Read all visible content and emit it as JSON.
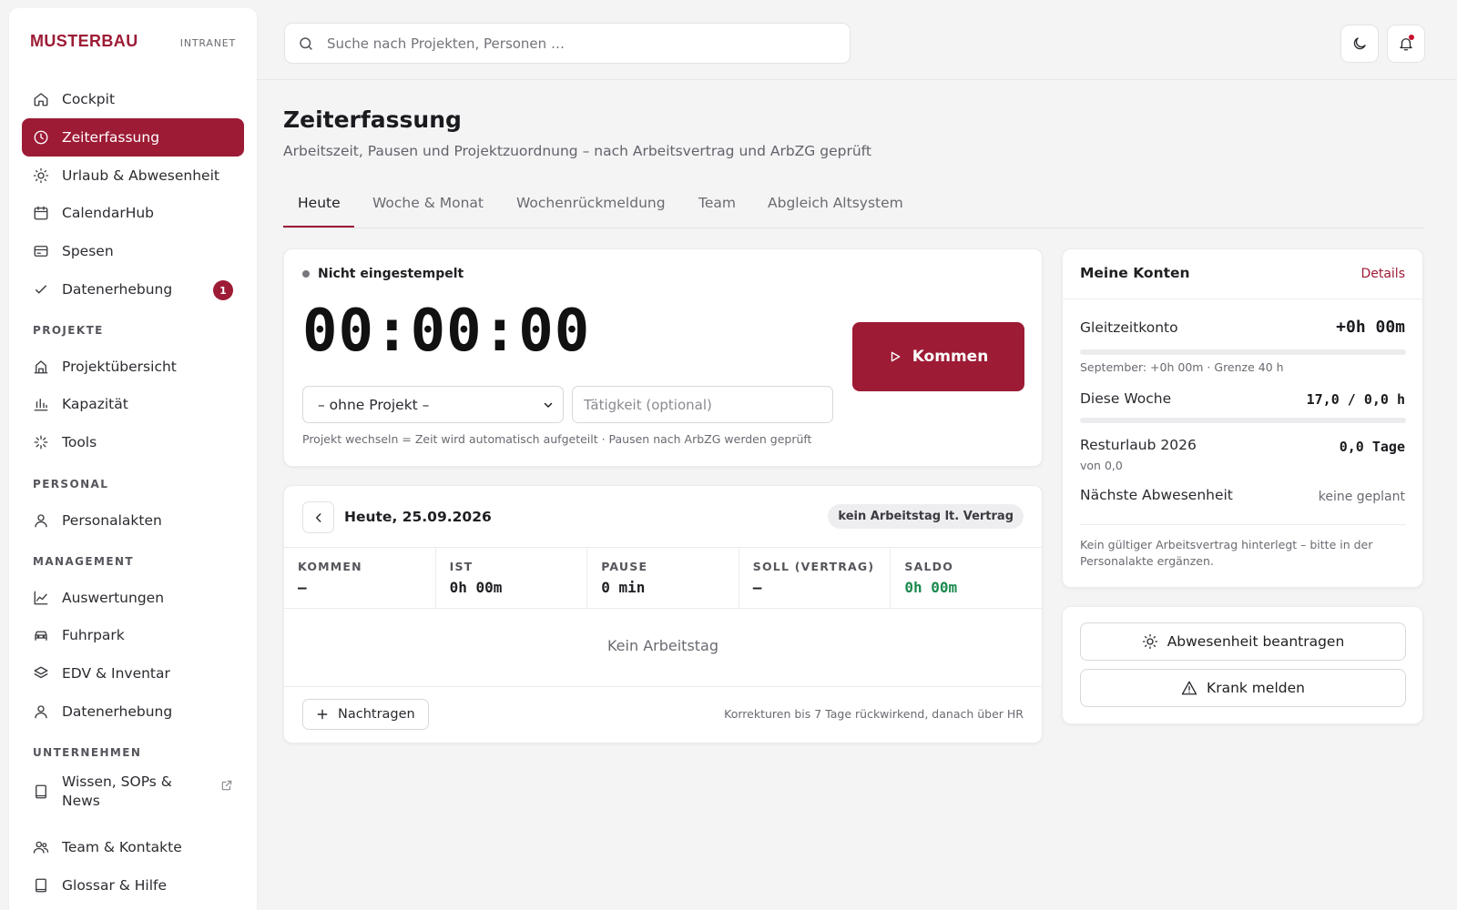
{
  "brand": {
    "name": "MUSTERBAU",
    "subtitle": "INTRANET"
  },
  "sidebar": {
    "items": [
      {
        "label": "Cockpit",
        "icon": "home-icon"
      },
      {
        "label": "Zeiterfassung",
        "icon": "clock-icon",
        "active": true
      },
      {
        "label": "Urlaub & Abwesenheit",
        "icon": "sun-icon"
      },
      {
        "label": "CalendarHub",
        "icon": "calendar-icon"
      },
      {
        "label": "Spesen",
        "icon": "receipt-icon"
      },
      {
        "label": "Datenerhebung",
        "icon": "check-icon",
        "badge": "1"
      }
    ],
    "sections": [
      {
        "label": "PROJEKTE",
        "items": [
          {
            "label": "Projektübersicht",
            "icon": "building-icon"
          },
          {
            "label": "Kapazität",
            "icon": "bar-chart-icon"
          },
          {
            "label": "Tools",
            "icon": "sparkle-icon"
          }
        ]
      },
      {
        "label": "PERSONAL",
        "items": [
          {
            "label": "Personalakten",
            "icon": "user-icon"
          }
        ]
      },
      {
        "label": "MANAGEMENT",
        "items": [
          {
            "label": "Auswertungen",
            "icon": "line-chart-icon"
          },
          {
            "label": "Fuhrpark",
            "icon": "car-icon"
          },
          {
            "label": "EDV & Inventar",
            "icon": "layers-icon"
          },
          {
            "label": "Datenerhebung",
            "icon": "user-icon"
          }
        ]
      },
      {
        "label": "UNTERNEHMEN",
        "items": [
          {
            "label": "Wissen, SOPs & News",
            "icon": "book-icon",
            "external": true
          },
          {
            "label": "Team & Kontakte",
            "icon": "users-icon"
          },
          {
            "label": "Glossar & Hilfe",
            "icon": "book-icon"
          }
        ]
      }
    ]
  },
  "search": {
    "placeholder": "Suche nach Projekten, Personen …"
  },
  "topbar": {
    "icons": [
      "moon-icon",
      "bell-icon"
    ]
  },
  "page": {
    "title": "Zeiterfassung",
    "subtitle": "Arbeitszeit, Pausen und Projektzuordnung – nach Arbeitsvertrag und ArbZG geprüft"
  },
  "tabs": [
    {
      "label": "Heute",
      "active": true
    },
    {
      "label": "Woche & Monat"
    },
    {
      "label": "Wochenrückmeldung"
    },
    {
      "label": "Team"
    },
    {
      "label": "Abgleich Altsystem"
    }
  ],
  "clock": {
    "status": "Nicht eingestempelt",
    "timer": "00:00:00",
    "button": "Kommen",
    "project_select": "– ohne Projekt –",
    "activity_placeholder": "Tätigkeit (optional)",
    "hint": "Projekt wechseln = Zeit wird automatisch aufgeteilt · Pausen nach ArbZG werden geprüft"
  },
  "day": {
    "title": "Heute, 25.09.2026",
    "badge": "kein Arbeitstag lt. Vertrag",
    "stats": [
      {
        "label": "KOMMEN",
        "value": "–"
      },
      {
        "label": "IST",
        "value": "0h 00m"
      },
      {
        "label": "PAUSE",
        "value": "0 min"
      },
      {
        "label": "SOLL (VERTRAG)",
        "value": "–"
      },
      {
        "label": "SALDO",
        "value": "0h 00m",
        "positive": true
      }
    ],
    "empty": "Kein Arbeitstag",
    "add_button": "Nachtragen",
    "footer_hint": "Korrekturen bis 7 Tage rückwirkend, danach über HR"
  },
  "accounts": {
    "title": "Meine Konten",
    "details_link": "Details",
    "gleitzeit": {
      "label": "Gleitzeitkonto",
      "value": "+0h 00m",
      "progress": 0,
      "sub": "September: +0h 00m · Grenze 40 h"
    },
    "week": {
      "label": "Diese Woche",
      "value": "17,0 / 0,0 h",
      "progress": 0
    },
    "vacation": {
      "label": "Resturlaub 2026",
      "value": "0,0 Tage",
      "sub": "von 0,0"
    },
    "next_absence": {
      "label": "Nächste Abwesenheit",
      "value": "keine geplant"
    },
    "note": "Kein gültiger Arbeitsvertrag hinterlegt – bitte in der Personalakte ergänzen."
  },
  "actions": [
    {
      "label": "Abwesenheit beantragen",
      "icon": "sun-icon"
    },
    {
      "label": "Krank melden",
      "icon": "warning-icon"
    }
  ],
  "colors": {
    "accent": "#9d1b35",
    "positive": "#1a8a4e",
    "background": "#f4f4f5"
  }
}
